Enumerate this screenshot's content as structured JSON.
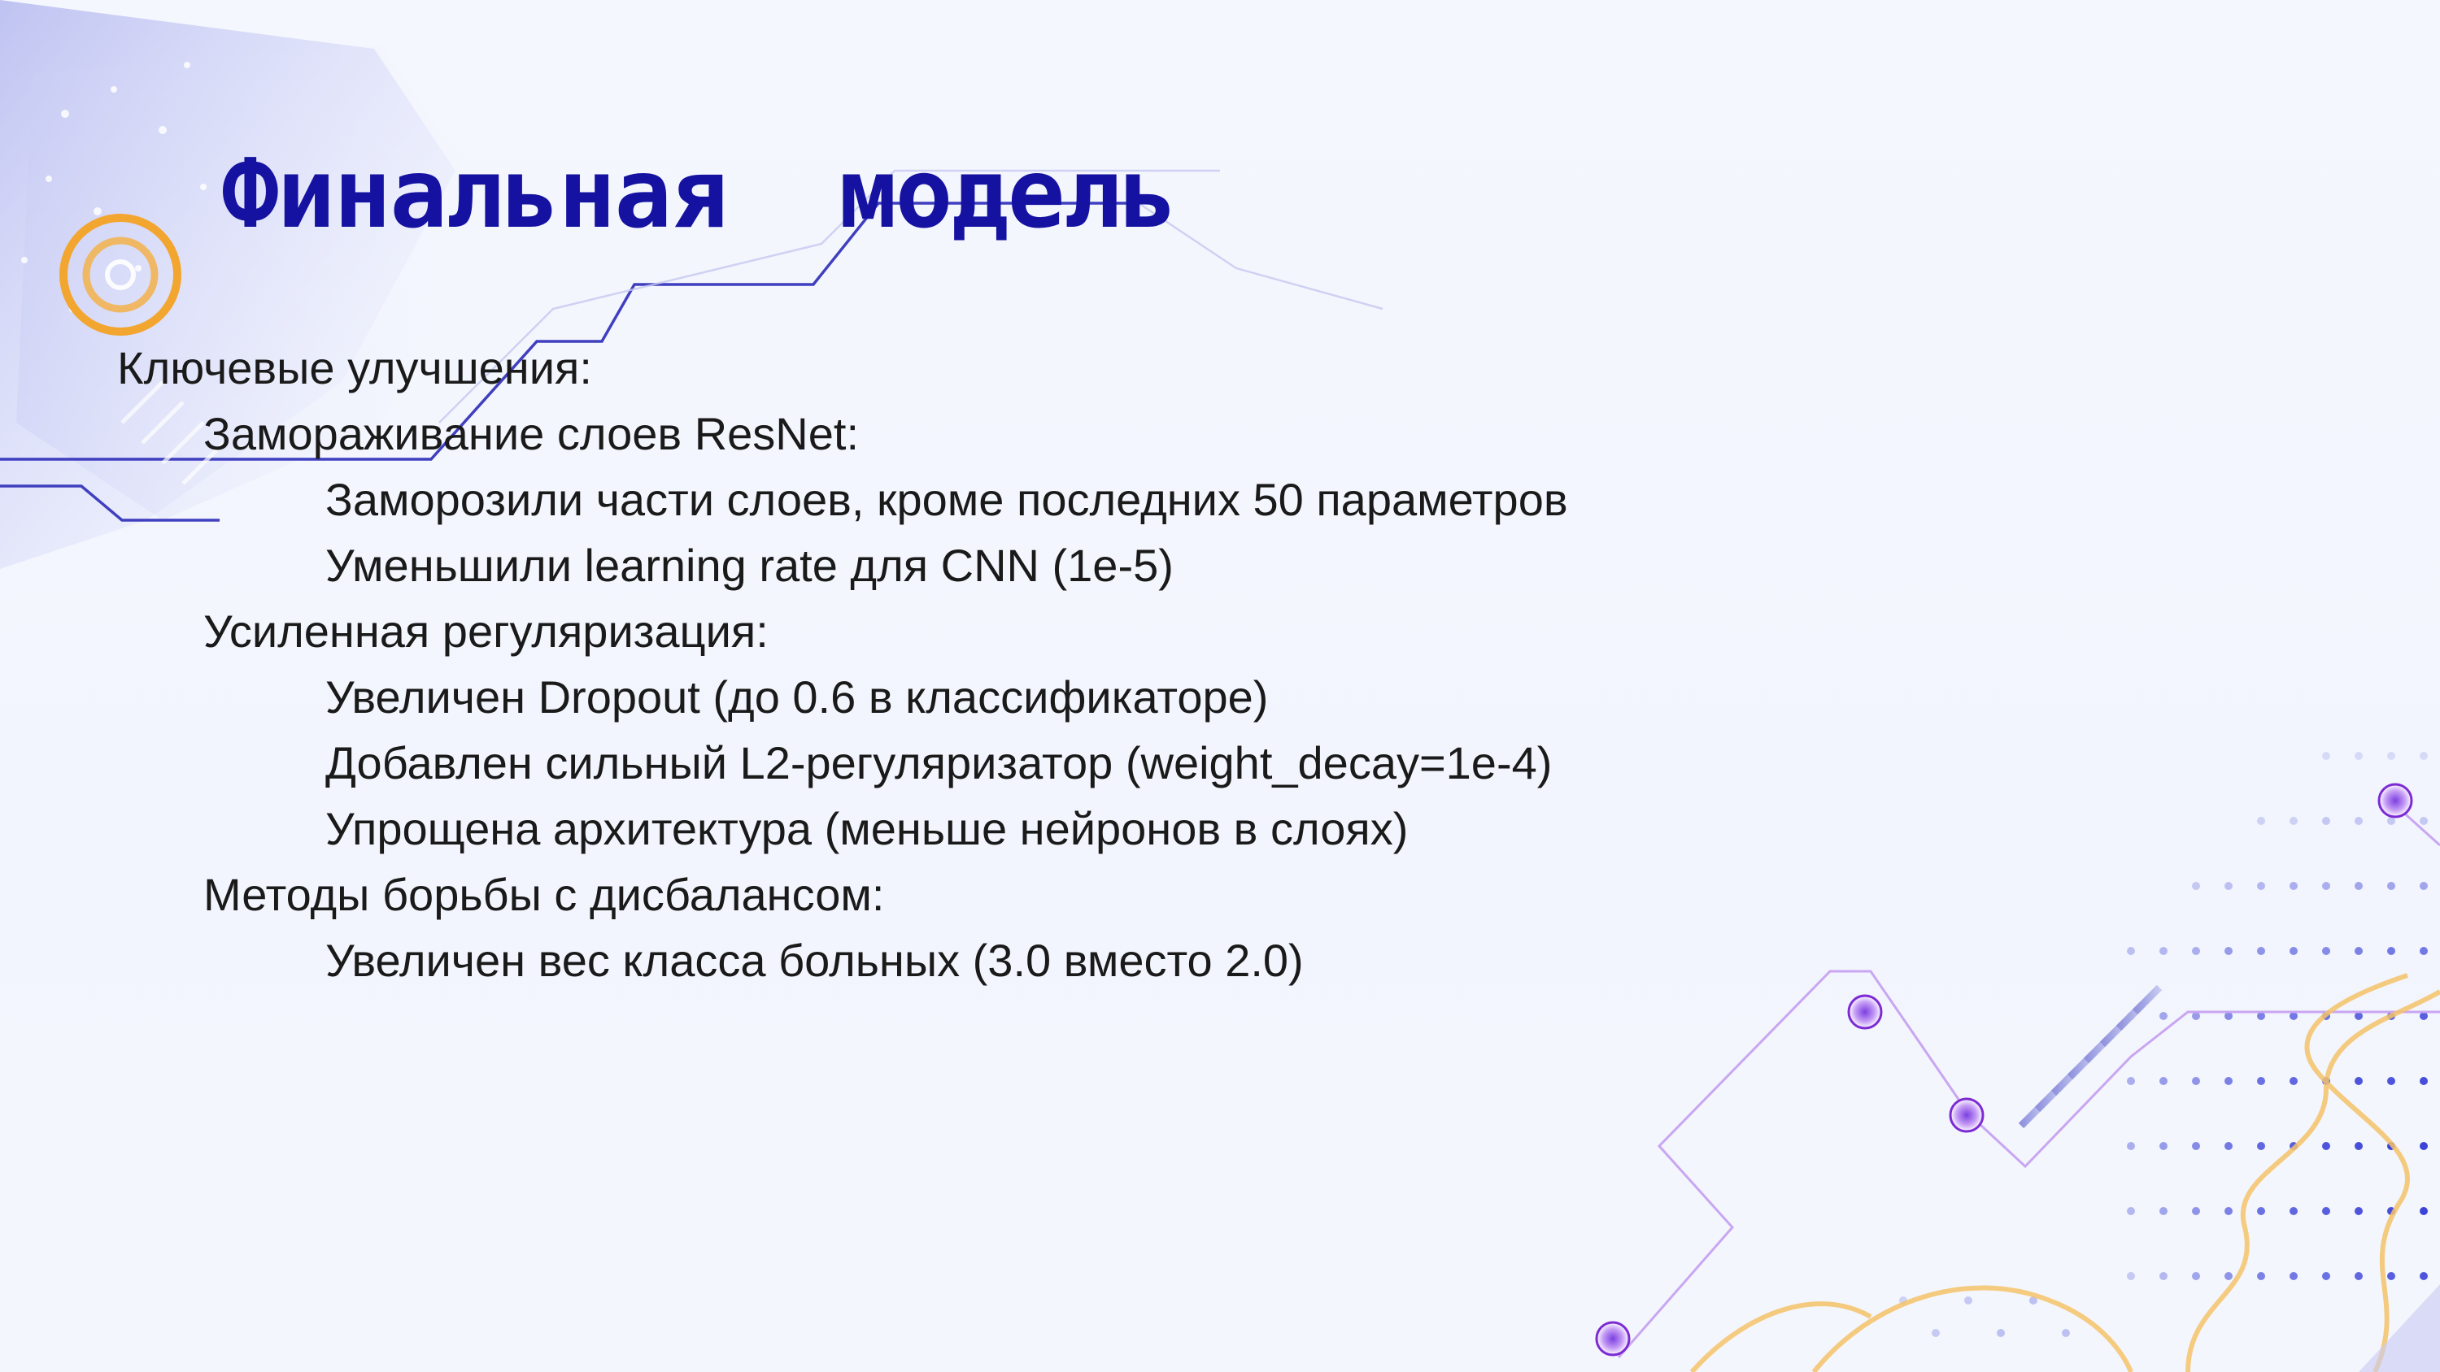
{
  "slide": {
    "title": "Финальная  модель",
    "lines": [
      {
        "level": 1,
        "text": "Ключевые улучшения:"
      },
      {
        "level": 2,
        "text": "Замораживание слоев ResNet:"
      },
      {
        "level": 3,
        "text": "Заморозили части слоев, кроме последних 50 параметров"
      },
      {
        "level": 3,
        "text": "Уменьшили learning rate для CNN (1e-5)"
      },
      {
        "level": 2,
        "text": "Усиленная регуляризация:"
      },
      {
        "level": 3,
        "text": "Увеличен Dropout (до 0.6 в классификаторе)"
      },
      {
        "level": 3,
        "text": "Добавлен сильный L2-регуляризатор (weight_decay=1e-4)"
      },
      {
        "level": 3,
        "text": "Упрощена архитектура (меньше нейронов в слоях)"
      },
      {
        "level": 2,
        "text": "Методы борьбы с дисбалансом:"
      },
      {
        "level": 3,
        "text": "Увеличен вес класса больных (3.0 вместо 2.0)"
      }
    ]
  },
  "colors": {
    "title": "#1512a2",
    "text": "#1a1a1a",
    "accent_orange": "#f2a62f",
    "accent_purple": "#9a4fe0",
    "circuit_blue": "#3f3fbf"
  },
  "icons": {
    "ring": "orange-ring-icon",
    "node": "circuit-node-icon"
  }
}
